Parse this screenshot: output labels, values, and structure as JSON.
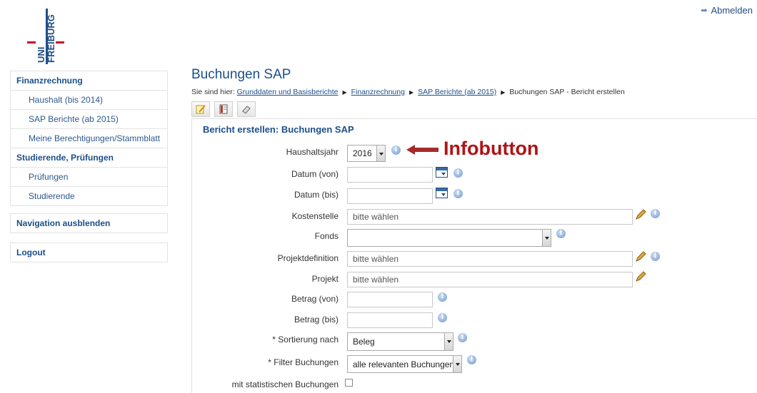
{
  "logo": {
    "line1": "UNI",
    "line2": "FREIBURG"
  },
  "header": {
    "logout_label": "Abmelden"
  },
  "nav": {
    "items": [
      {
        "label": "Finanzrechnung",
        "type": "head"
      },
      {
        "label": "Haushalt (bis 2014)",
        "type": "sub"
      },
      {
        "label": "SAP Berichte (ab 2015)",
        "type": "sub"
      },
      {
        "label": "Meine Berechtigungen/Stammblatt",
        "type": "sub"
      },
      {
        "label": "Studierende, Prüfungen",
        "type": "head"
      },
      {
        "label": "Prüfungen",
        "type": "sub"
      },
      {
        "label": "Studierende",
        "type": "sub"
      }
    ],
    "hide_label": "Navigation ausblenden",
    "logout_label": "Logout"
  },
  "page": {
    "title": "Buchungen SAP",
    "breadcrumb_prefix": "Sie sind hier:",
    "breadcrumbs": [
      "Grunddaten und Basisberichte",
      "Finanzrechnung",
      "SAP Berichte (ab 2015)",
      "Buchungen SAP - Bericht erstellen"
    ]
  },
  "form": {
    "title": "Bericht erstellen: Buchungen SAP",
    "haushaltsjahr": {
      "label": "Haushaltsjahr",
      "value": "2016"
    },
    "datum_von": {
      "label": "Datum (von)",
      "value": ""
    },
    "datum_bis": {
      "label": "Datum (bis)",
      "value": ""
    },
    "kostenstelle": {
      "label": "Kostenstelle",
      "placeholder": "bitte wählen"
    },
    "fonds": {
      "label": "Fonds",
      "value": ""
    },
    "projektdefinition": {
      "label": "Projektdefinition",
      "placeholder": "bitte wählen"
    },
    "projekt": {
      "label": "Projekt",
      "placeholder": "bitte wählen"
    },
    "betrag_von": {
      "label": "Betrag (von)",
      "value": ""
    },
    "betrag_bis": {
      "label": "Betrag (bis)",
      "value": ""
    },
    "sortierung": {
      "label": "* Sortierung nach",
      "value": "Beleg"
    },
    "filter": {
      "label": "* Filter Buchungen",
      "value": "alle relevanten Buchungen"
    },
    "statistisch": {
      "label": "mit statistischen Buchungen",
      "checked": false
    }
  },
  "annotation": {
    "label": "Infobutton",
    "color": "#b01316"
  },
  "icons": {
    "info": "i"
  },
  "colors": {
    "accent": "#1b4f8a",
    "logo_blue": "#1f4f87",
    "logo_red": "#c8102e"
  }
}
